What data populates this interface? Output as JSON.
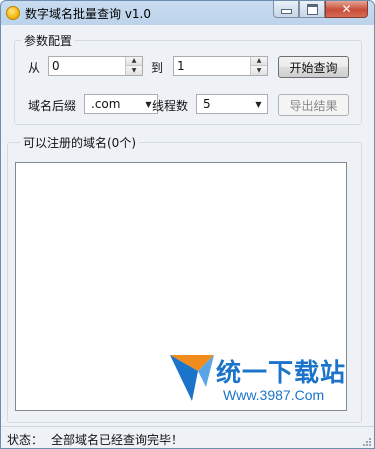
{
  "window": {
    "title": "数字域名批量查询 v1.0"
  },
  "config": {
    "group_label": "参数配置",
    "from_label": "从",
    "from_value": "0",
    "to_label": "到",
    "to_value": "1",
    "start_button": "开始查询",
    "suffix_label": "域名后缀",
    "suffix_value": ".com",
    "threads_label": "线程数",
    "threads_value": "5",
    "export_button": "导出结果"
  },
  "results": {
    "group_label": "可以注册的域名(0个)"
  },
  "watermark": {
    "name": "统一下载站",
    "url": "Www.3987.Com"
  },
  "status": {
    "label": "状态：",
    "text": "全部域名已经查询完毕！"
  },
  "colors": {
    "title_bar": "#bcd3eb",
    "window_bg": "#eef2f7",
    "close_button": "#c84d37",
    "watermark_blue": "#1b74c9",
    "watermark_orange": "#f08c1e"
  },
  "icons": {
    "app": "app-icon",
    "minimize": "minimize-icon",
    "maximize": "maximize-icon",
    "close": "close-icon"
  }
}
